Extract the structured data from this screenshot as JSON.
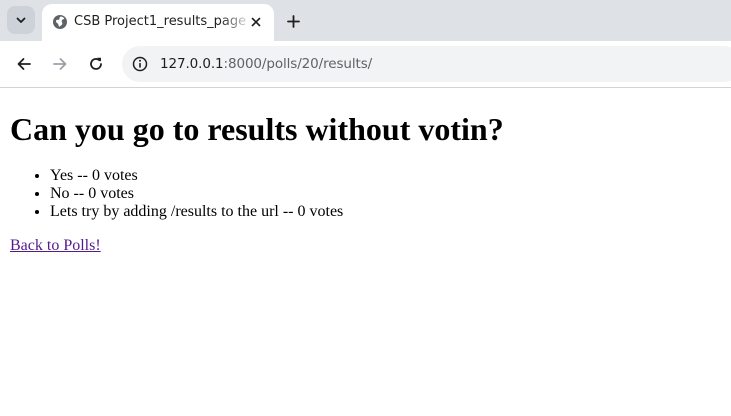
{
  "browser": {
    "tab": {
      "title": "CSB Project1_results_page",
      "favicon": "globe-icon"
    },
    "icons": {
      "tab_search": "chevron-down-icon",
      "tab_close": "close-icon",
      "new_tab": "plus-icon",
      "back": "arrow-left-icon",
      "forward": "arrow-right-icon",
      "reload": "reload-icon",
      "site_info": "info-icon"
    },
    "address_bar": {
      "host": "127.0.0.1",
      "rest": ":8000/polls/20/results/"
    }
  },
  "page": {
    "question": "Can you go to results without votin?",
    "choices": [
      {
        "text": "Yes -- 0 votes"
      },
      {
        "text": "No -- 0 votes"
      },
      {
        "text": "Lets try by adding /results to the url -- 0 votes"
      }
    ],
    "back_link": "Back to Polls!"
  },
  "colors": {
    "tabstrip": "#dee1e6",
    "omnibox": "#f1f3f4",
    "visited_link": "#551a8b"
  }
}
